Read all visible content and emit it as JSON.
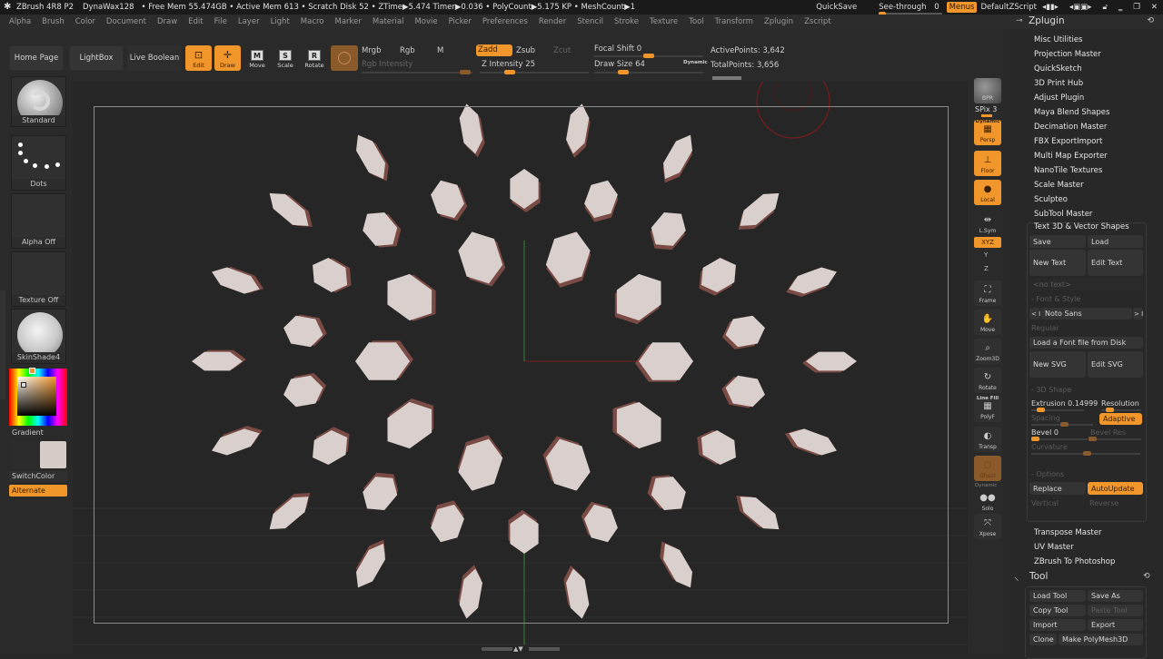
{
  "titlebar": {
    "app": "ZBrush 4R8 P2",
    "document": "DynaWax128",
    "stats": "• Free Mem 55.474GB • Active Mem 613 • Scratch Disk 52 • ZTime▶5.474 Timer▶0.036 • PolyCount▶5.175 KP • MeshCount▶1",
    "quicksave": "QuickSave",
    "see_through_label": "See-through",
    "see_through_value": "0",
    "see_through_fraction": 0.0,
    "menus": "Menus",
    "default_zscript": "DefaultZScript"
  },
  "menubar": [
    "Alpha",
    "Brush",
    "Color",
    "Document",
    "Draw",
    "Edit",
    "File",
    "Layer",
    "Light",
    "Macro",
    "Marker",
    "Material",
    "Movie",
    "Picker",
    "Preferences",
    "Render",
    "Stencil",
    "Stroke",
    "Texture",
    "Tool",
    "Transform",
    "Zplugin",
    "Zscript"
  ],
  "toolbar": {
    "home_page": "Home Page",
    "lightbox": "LightBox",
    "live_boolean": "Live Boolean",
    "edit": "Edit",
    "draw": "Draw",
    "move": "Move",
    "scale": "Scale",
    "rotate": "Rotate",
    "mrgb": "Mrgb",
    "rgb": "Rgb",
    "m": "M",
    "rgb_intensity": "Rgb Intensity",
    "zadd": "Zadd",
    "zsub": "Zsub",
    "zcut": "Zcut",
    "z_intensity_label": "Z Intensity",
    "z_intensity": "25",
    "focal_shift_label": "Focal Shift",
    "focal_shift": "0",
    "draw_size_label": "Draw Size",
    "draw_size": "64",
    "dynamic": "Dynamic",
    "active_points": "ActivePoints: 3,642",
    "total_points": "TotalPoints: 3,656"
  },
  "leftpanel": {
    "brush": "Standard",
    "stroke": "Dots",
    "alpha": "Alpha Off",
    "texture": "Texture Off",
    "material": "SkinShade4",
    "gradient": "Gradient",
    "switchcolor": "SwitchColor",
    "alternate": "Alternate",
    "main_color": "#d6ccc8",
    "accent": "#f0962a"
  },
  "rightstrip": {
    "bpr": "BPR",
    "spix": "SPix 3",
    "dynamic": "Dynamic",
    "persp": "Persp",
    "floor": "Floor",
    "local": "Local",
    "lsym": "L.Sym",
    "xyz": "XYZ",
    "y": "Y",
    "z": "Z",
    "frame": "Frame",
    "move": "Move",
    "zoom3d": "Zoom3D",
    "rotate": "Rotate",
    "linefill": "Line Fill",
    "polyf": "PolyF",
    "transp": "Transp",
    "ghost": "Ghost",
    "dynamic2": "Dynamic",
    "solo": "Solo",
    "xpose": "Xpose"
  },
  "zplugin": {
    "title": "Zplugin",
    "items": [
      "Misc Utilities",
      "Projection Master",
      "QuickSketch",
      "3D Print Hub",
      "Adjust Plugin",
      "Maya Blend Shapes",
      "Decimation Master",
      "FBX ExportImport",
      "Multi Map Exporter",
      "NanoTile Textures",
      "Scale Master",
      "Sculpteo",
      "SubTool Master"
    ],
    "text3d": {
      "title": "Text 3D & Vector Shapes",
      "save": "Save",
      "load": "Load",
      "new_text": "New Text",
      "edit_text": "Edit Text",
      "no_text": "<no text>",
      "font_style": "- Font & Style",
      "prev": "< I",
      "font": "Noto Sans",
      "next": "> I",
      "style": "Regular",
      "load_font": "Load a Font file from Disk",
      "new_svg": "New SVG",
      "edit_svg": "Edit SVG",
      "shape3d": "- 3D Shape",
      "extrusion": "Extrusion 0.14999",
      "resolution": "Resolution",
      "spacing": "Spacing",
      "adaptive": "Adaptive",
      "bevel": "Bevel 0",
      "bevel_res": "Bevel Res",
      "curvature": "Curvature",
      "options": "- Options",
      "replace": "Replace",
      "autoupdate": "AutoUpdate",
      "vertical": "Vertical",
      "reverse": "Reverse"
    },
    "items_after": [
      "Transpose Master",
      "UV Master",
      "ZBrush To Photoshop"
    ]
  },
  "tool": {
    "title": "Tool",
    "load_tool": "Load Tool",
    "save_as": "Save As",
    "copy_tool": "Copy Tool",
    "paste_tool": "Paste Tool",
    "import": "Import",
    "export": "Export",
    "clone": "Clone",
    "make_polymesh": "Make PolyMesh3D"
  }
}
